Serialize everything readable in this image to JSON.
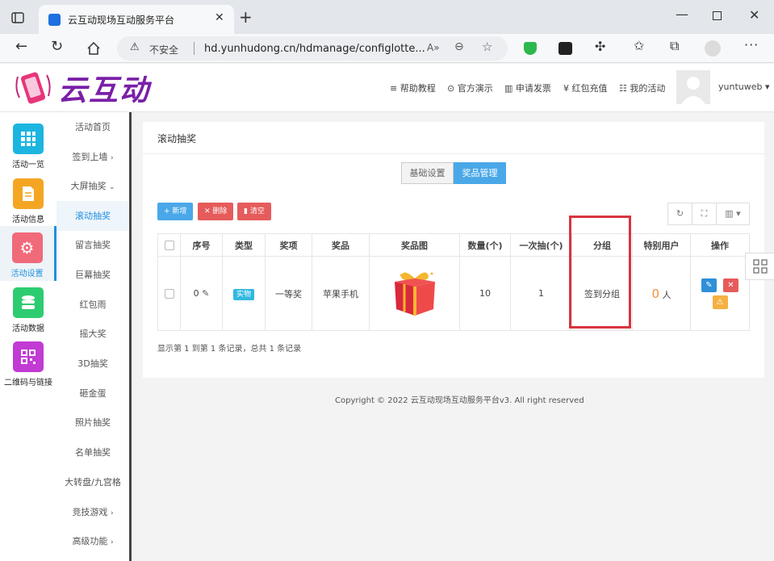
{
  "browser": {
    "tab_title": "云互动现场互动服务平台",
    "security": "不安全",
    "url": "hd.yunhudong.cn/hdmanage/configlotte..."
  },
  "header": {
    "logo_text": "云互动",
    "nav": [
      "帮助教程",
      "官方演示",
      "申请发票",
      "红包充值",
      "我的活动"
    ],
    "username": "yuntuweb"
  },
  "sidebar_main": [
    {
      "label": "活动一览",
      "icon": "grid-icon",
      "color": "#1cb5e0"
    },
    {
      "label": "活动信息",
      "icon": "document-icon",
      "color": "#f4a623"
    },
    {
      "label": "活动设置",
      "icon": "gear-icon",
      "color": "#f06a7a"
    },
    {
      "label": "活动数据",
      "icon": "database-icon",
      "color": "#2ecc71"
    },
    {
      "label": "二维码与链接",
      "icon": "qrcode-icon",
      "color": "#c23bd4"
    }
  ],
  "sidebar_sub": [
    "活动首页",
    "签到上墙",
    "大屏抽奖",
    "滚动抽奖",
    "留言抽奖",
    "巨幕抽奖",
    "红包雨",
    "摇大奖",
    "3D抽奖",
    "砸金蛋",
    "照片抽奖",
    "名单抽奖",
    "大转盘/九宫格",
    "竞技游戏",
    "高级功能"
  ],
  "panel": {
    "title": "滚动抽奖",
    "tabs": [
      "基础设置",
      "奖品管理"
    ],
    "active_tab": 1
  },
  "toolbar": {
    "add": "+ 新增",
    "delete": "✕ 删除",
    "clear": "▮ 清空"
  },
  "table": {
    "headers": [
      "序号",
      "类型",
      "奖项",
      "奖品",
      "奖品图",
      "数量(个)",
      "一次抽(个)",
      "分组",
      "特别用户",
      "操作"
    ],
    "rows": [
      {
        "index": "0",
        "type": "实物",
        "award": "一等奖",
        "prize": "苹果手机",
        "qty": "10",
        "per_draw": "1",
        "group": "签到分组",
        "special_count": "0",
        "special_unit": "人"
      }
    ]
  },
  "pagination": "显示第 1 到第 1 条记录，总共 1 条记录",
  "footer": "Copyright © 2022 云互动现场互动服务平台v3. All right reserved"
}
